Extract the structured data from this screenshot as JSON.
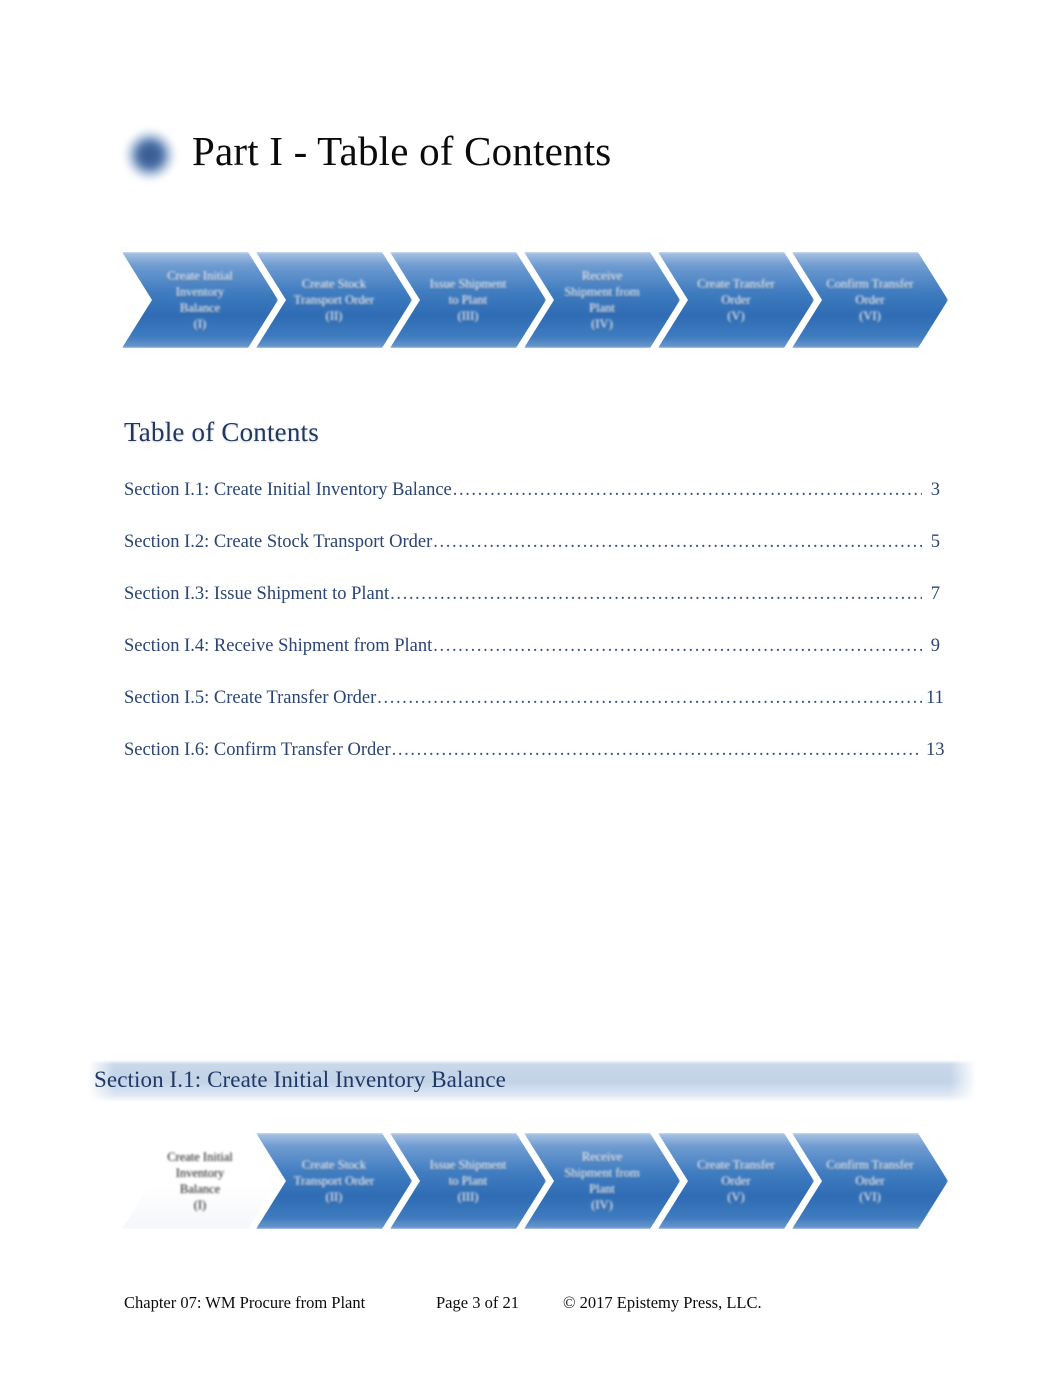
{
  "document": {
    "title": "Part I - Table of Contents",
    "title_icon": "blue-rounded-square-icon"
  },
  "process_flow_top": {
    "steps": [
      {
        "line1": "Create Initial",
        "line2": "Inventory",
        "line3": "Balance",
        "numeral": "(I)",
        "active": false
      },
      {
        "line1": "Create Stock",
        "line2": "Transport Order",
        "line3": "",
        "numeral": "(II)",
        "active": false
      },
      {
        "line1": "Issue Shipment",
        "line2": "to Plant",
        "line3": "",
        "numeral": "(III)",
        "active": false
      },
      {
        "line1": "Receive",
        "line2": "Shipment from",
        "line3": "Plant",
        "numeral": "(IV)",
        "active": false
      },
      {
        "line1": "Create Transfer",
        "line2": "Order",
        "line3": "",
        "numeral": "(V)",
        "active": false
      },
      {
        "line1": "Confirm Transfer",
        "line2": "Order",
        "line3": "",
        "numeral": "(VI)",
        "active": false
      }
    ]
  },
  "toc": {
    "heading": "Table of Contents",
    "entries": [
      {
        "text": "Section I.1: Create Initial Inventory Balance",
        "page": "3"
      },
      {
        "text": "Section I.2: Create Stock Transport Order",
        "page": "5"
      },
      {
        "text": "Section I.3: Issue Shipment to Plant",
        "page": "7"
      },
      {
        "text": "Section I.4: Receive Shipment from Plant",
        "page": "9"
      },
      {
        "text": "Section I.5: Create Transfer Order",
        "page": "11"
      },
      {
        "text": "Section I.6: Confirm Transfer Order",
        "page": "13"
      }
    ]
  },
  "section": {
    "title": "Section I.1: Create Initial Inventory Balance"
  },
  "process_flow_section": {
    "steps": [
      {
        "line1": "Create Initial",
        "line2": "Inventory",
        "line3": "Balance",
        "numeral": "(I)",
        "active": true
      },
      {
        "line1": "Create Stock",
        "line2": "Transport Order",
        "line3": "",
        "numeral": "(II)",
        "active": false
      },
      {
        "line1": "Issue Shipment",
        "line2": "to Plant",
        "line3": "",
        "numeral": "(III)",
        "active": false
      },
      {
        "line1": "Receive",
        "line2": "Shipment from",
        "line3": "Plant",
        "numeral": "(IV)",
        "active": false
      },
      {
        "line1": "Create Transfer",
        "line2": "Order",
        "line3": "",
        "numeral": "(V)",
        "active": false
      },
      {
        "line1": "Confirm Transfer",
        "line2": "Order",
        "line3": "",
        "numeral": "(VI)",
        "active": false
      }
    ]
  },
  "footer": {
    "chapter": "Chapter 07: WM Procure from Plant",
    "page": "Page 3 of 21",
    "copyright": "© 2017 Epistemy Press, LLC."
  },
  "colors": {
    "chevron_blue_dark": "#2f6cb4",
    "chevron_blue_light": "#a9c4e4",
    "toc_text": "#2a4474",
    "section_heading_text": "#1f3864",
    "section_bar": "#c2d3e8"
  }
}
